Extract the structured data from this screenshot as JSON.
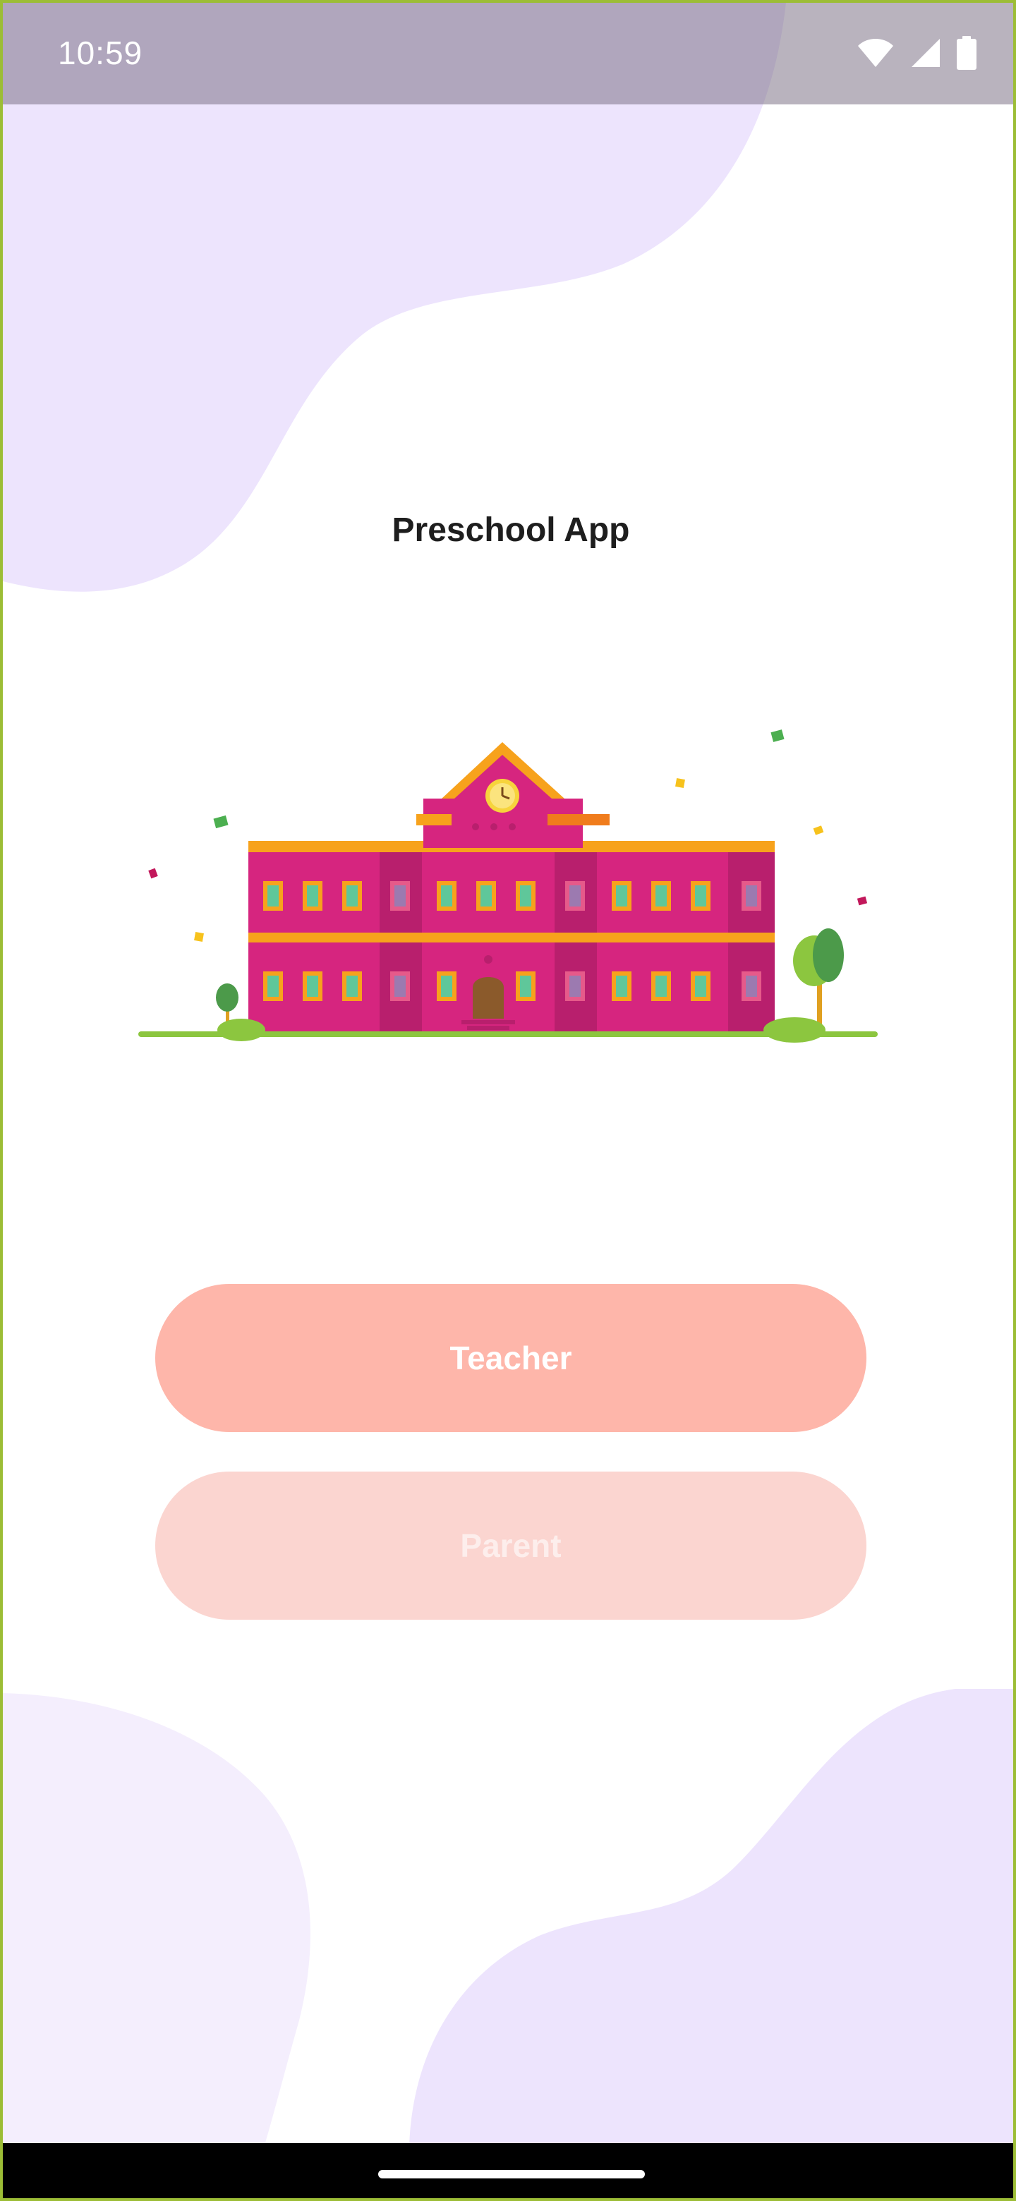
{
  "status_bar": {
    "time": "10:59",
    "icons": [
      "wifi-icon",
      "cell-signal-icon",
      "battery-icon"
    ]
  },
  "app": {
    "title": "Preschool App",
    "illustration": "school-building-illustration"
  },
  "buttons": {
    "teacher_label": "Teacher",
    "parent_label": "Parent"
  },
  "colors": {
    "background": "#ffffff",
    "blob_primary": "#ede4fd",
    "blob_secondary": "#f4eefd",
    "teacher_button": "#feb6aa",
    "parent_button": "#fbd5d0",
    "building_main": "#d6257f",
    "building_trim": "#f7a21c",
    "window_glass": "#5fc79a",
    "tree_green": "#8cc63f",
    "ground": "#8cc63f"
  },
  "nav_bar": {
    "home_indicator": "home-indicator"
  }
}
